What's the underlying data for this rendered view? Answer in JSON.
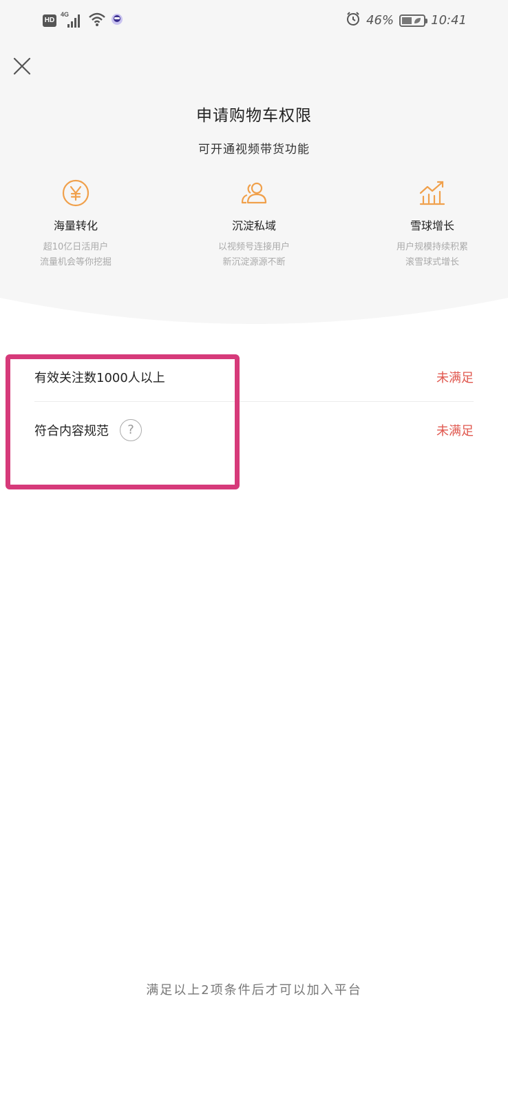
{
  "status_bar": {
    "hd": "HD",
    "network": "4G",
    "battery_percent": "46%",
    "time": "10:41"
  },
  "header": {
    "title": "申请购物车权限",
    "subtitle": "可开通视频带货功能"
  },
  "features": [
    {
      "name": "海量转化",
      "desc_line1": "超10亿日活用户",
      "desc_line2": "流量机会等你挖掘",
      "icon": "yen-coin-icon"
    },
    {
      "name": "沉淀私域",
      "desc_line1": "以视频号连接用户",
      "desc_line2": "新沉淀源源不断",
      "icon": "users-icon"
    },
    {
      "name": "雪球增长",
      "desc_line1": "用户规模持续积累",
      "desc_line2": "滚雪球式增长",
      "icon": "growth-chart-icon"
    }
  ],
  "conditions": [
    {
      "label": "有效关注数1000人以上",
      "status": "未满足"
    },
    {
      "label": "符合内容规范",
      "status": "未满足",
      "help": "?"
    }
  ],
  "footer": {
    "note": "满足以上2项条件后才可以加入平台"
  },
  "colors": {
    "accent_orange": "#f0a04b",
    "status_red": "#e0584f",
    "highlight_pink": "#d63a7a",
    "top_bg": "#f6f6f6"
  }
}
